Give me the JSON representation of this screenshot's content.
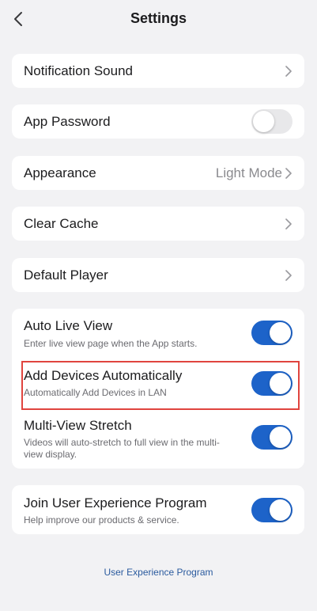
{
  "header": {
    "title": "Settings",
    "back_icon": "chevron-left-icon"
  },
  "rows": {
    "notification_sound": {
      "label": "Notification Sound"
    },
    "app_password": {
      "label": "App Password",
      "toggle": false
    },
    "appearance": {
      "label": "Appearance",
      "value": "Light Mode"
    },
    "clear_cache": {
      "label": "Clear Cache"
    },
    "default_player": {
      "label": "Default Player"
    },
    "auto_live_view": {
      "label": "Auto Live View",
      "subtitle": "Enter live view page when the App starts.",
      "toggle": true
    },
    "add_devices_automatically": {
      "label": "Add Devices Automatically",
      "subtitle": "Automatically Add Devices in LAN",
      "toggle": true,
      "highlighted": true
    },
    "multi_view_stretch": {
      "label": "Multi-View Stretch",
      "subtitle": "Videos will auto-stretch to full view in the multi-view display.",
      "toggle": true
    },
    "join_user_experience": {
      "label": "Join User Experience Program",
      "subtitle": "Help improve our products & service.",
      "toggle": true
    }
  },
  "footer": {
    "link": "User Experience Program"
  },
  "colors": {
    "background": "#f2f2f4",
    "toggle_on": "#1d63c9",
    "toggle_off": "#e8e8ea",
    "highlight": "#e0443e",
    "link": "#2a5a9e"
  }
}
